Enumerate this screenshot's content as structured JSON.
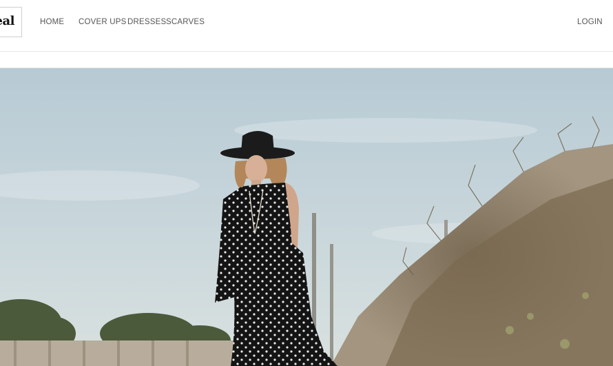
{
  "brand": {
    "logo_text": "Seal"
  },
  "nav": {
    "items": [
      {
        "label": "HOME"
      },
      {
        "label": "COVER UPS"
      },
      {
        "label": "DRESSES"
      },
      {
        "label": "SCARVES"
      }
    ],
    "login_label": "LOGIN"
  },
  "hero": {
    "colors": {
      "sky_top": "#b9ccd6",
      "sky_bottom": "#d6e0e2",
      "foliage": "#8c7d66",
      "dress": "#141414"
    }
  }
}
